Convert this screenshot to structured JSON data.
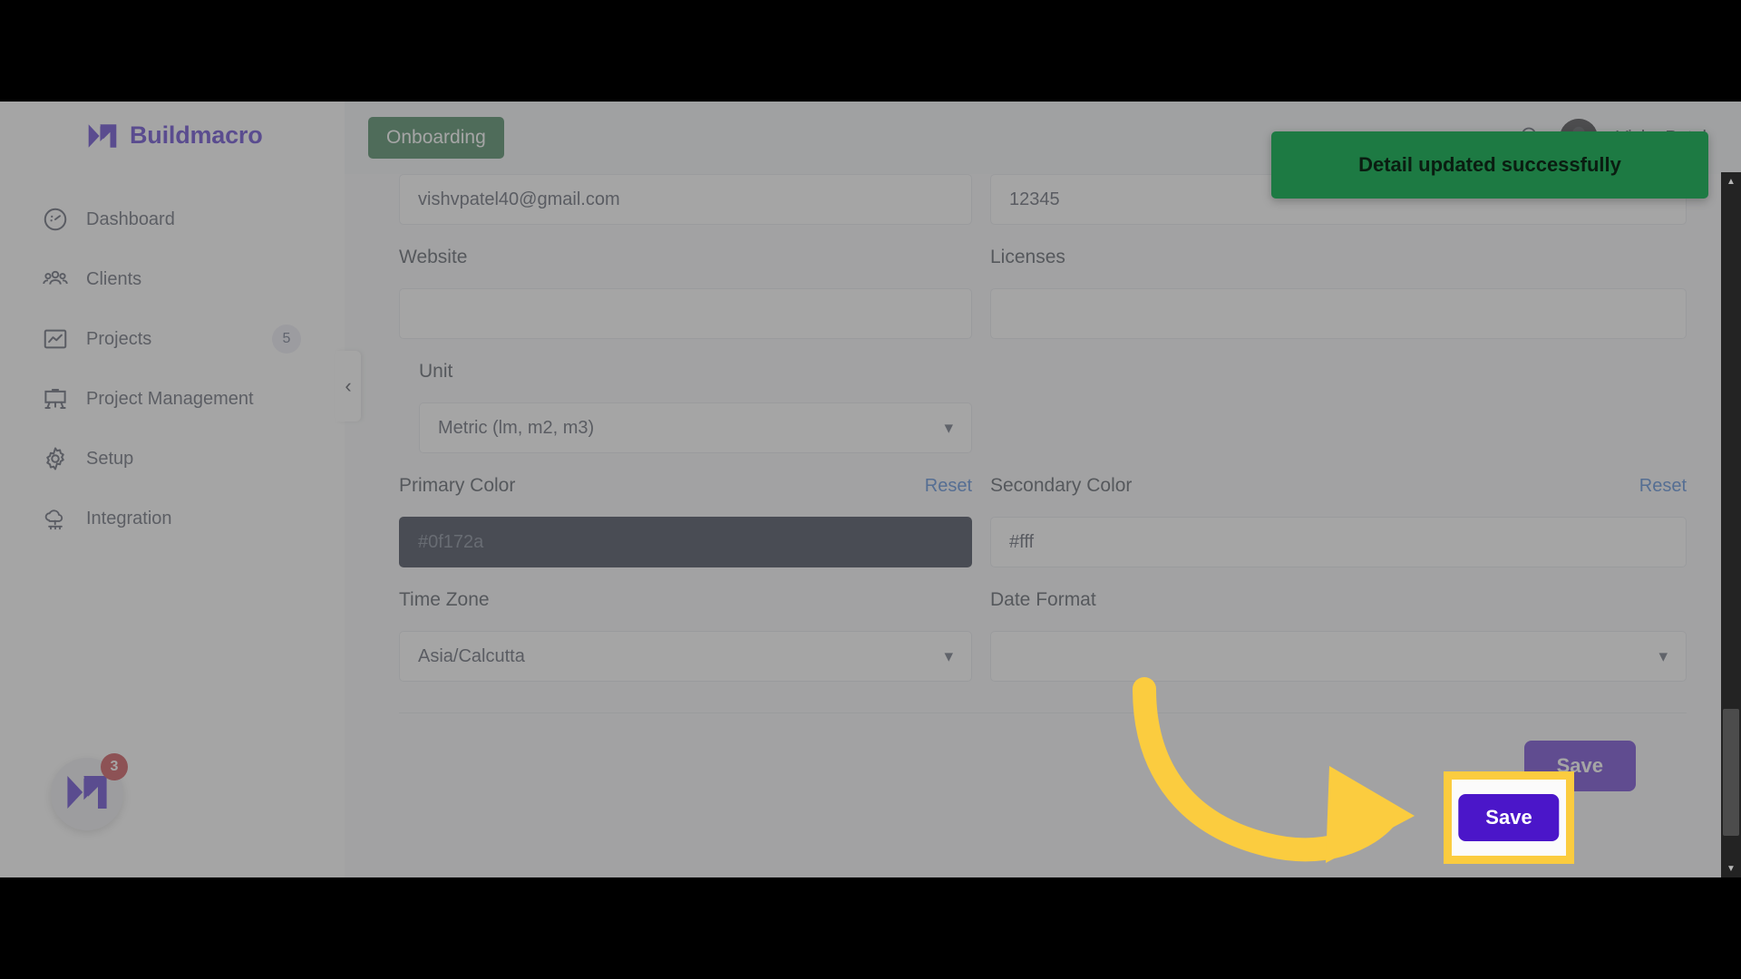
{
  "app": {
    "brand_name": "Buildmacro",
    "brand_color": "#3b17c4"
  },
  "sidebar": {
    "items": [
      {
        "label": "Dashboard",
        "icon": "gauge-icon",
        "badge": null
      },
      {
        "label": "Clients",
        "icon": "people-icon",
        "badge": null
      },
      {
        "label": "Projects",
        "icon": "chart-box-icon",
        "badge": "5"
      },
      {
        "label": "Project Management",
        "icon": "easel-icon",
        "badge": null
      },
      {
        "label": "Setup",
        "icon": "gear-icon",
        "badge": null
      },
      {
        "label": "Integration",
        "icon": "cloud-network-icon",
        "badge": null
      }
    ],
    "collapse_icon": "chevron-left-icon",
    "help_bubble": {
      "badge": "3",
      "icon": "buildmacro-logo-icon"
    }
  },
  "topbar": {
    "tab_label": "Onboarding",
    "bell_icon": "bell-icon",
    "user_name": "Vishv Patel",
    "avatar_initials": ""
  },
  "form": {
    "email": {
      "label": "",
      "value": "vishvpatel40@gmail.com"
    },
    "postcode": {
      "label": "",
      "value": "12345"
    },
    "website": {
      "label": "Website",
      "value": ""
    },
    "licenses": {
      "label": "Licenses",
      "value": ""
    },
    "unit": {
      "label": "Unit",
      "value": "Metric (lm, m2, m3)",
      "chevron": "chevron-down-icon"
    },
    "primary_color": {
      "label": "Primary Color",
      "reset_label": "Reset",
      "value": "#0f172a",
      "swatch": "#0f172a"
    },
    "secondary_color": {
      "label": "Secondary Color",
      "reset_label": "Reset",
      "value": "#fff",
      "swatch": "#ffffff"
    },
    "time_zone": {
      "label": "Time Zone",
      "value": "Asia/Calcutta",
      "chevron": "chevron-down-icon"
    },
    "date_format": {
      "label": "Date Format",
      "value": "",
      "chevron": "chevron-down-icon"
    },
    "save_label": "Save"
  },
  "toast": {
    "message": "Detail updated successfully",
    "background": "#1d7a43"
  },
  "annotation": {
    "highlight_color": "#fbcc3f",
    "arrow_color": "#fbcc3f",
    "save_label": "Save"
  }
}
